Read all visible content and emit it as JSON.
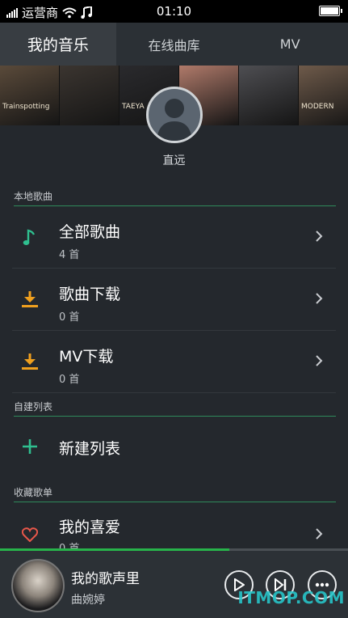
{
  "status_bar": {
    "carrier": "运营商",
    "time": "01:10"
  },
  "tabs": [
    {
      "label": "我的音乐"
    },
    {
      "label": "在线曲库"
    },
    {
      "label": "MV"
    }
  ],
  "banner": {
    "cover_texts": [
      "Trainspotting",
      "",
      "TAEYA",
      "",
      "",
      "MODERN"
    ],
    "colors": [
      "#5a4a3a",
      "#3b3530",
      "#2a2a2d",
      "#b07a6a",
      "#4e4e52",
      "#6e5a4a"
    ]
  },
  "profile": {
    "name": "直远"
  },
  "sections": {
    "local": {
      "title": "本地歌曲"
    },
    "custom": {
      "title": "自建列表"
    },
    "favorite": {
      "title": "收藏歌单"
    }
  },
  "rows": [
    {
      "title": "全部歌曲",
      "count": "4 首",
      "icon": "music-note-icon"
    },
    {
      "title": "歌曲下载",
      "count": "0 首",
      "icon": "download-icon"
    },
    {
      "title": "MV下载",
      "count": "0 首",
      "icon": "download-icon"
    }
  ],
  "new_list": {
    "title": "新建列表"
  },
  "favorite_row": {
    "title": "我的喜爱",
    "count": "0 首"
  },
  "player": {
    "title": "我的歌声里",
    "artist": "曲婉婷",
    "progress_percent": 66,
    "watermark": "ITMOP.COM"
  },
  "colors": {
    "accent_green": "#27b34a",
    "download_orange": "#f0a01e",
    "music_teal": "#2fbf8f"
  }
}
